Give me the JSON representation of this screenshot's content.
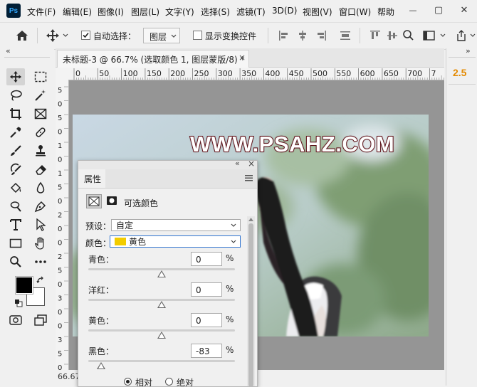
{
  "app": {
    "logo": "Ps"
  },
  "menubar": {
    "items": [
      "文件(F)",
      "编辑(E)",
      "图像(I)",
      "图层(L)",
      "文字(Y)",
      "选择(S)",
      "滤镜(T)",
      "3D(D)",
      "视图(V)",
      "窗口(W)",
      "帮助"
    ]
  },
  "window": {
    "minimize": "—",
    "restore": "▢",
    "close": "✕"
  },
  "options": {
    "auto_select_label": "自动选择：",
    "auto_select_checked": true,
    "target_value": "图层",
    "show_transform_label": "显示变换控件",
    "show_transform_checked": false
  },
  "document": {
    "tab_title": "未标题-3 @ 66.7% (选取颜色 1, 图层蒙版/8) *",
    "tab_close": "×",
    "ruler_h": [
      "0",
      "50",
      "100",
      "150",
      "200",
      "250",
      "300",
      "350",
      "400",
      "450",
      "500",
      "550",
      "600",
      "650",
      "700",
      "7"
    ],
    "ruler_v": [
      "5",
      "0",
      "5",
      "0",
      "1",
      "0",
      "1",
      "5",
      "0",
      "2",
      "0",
      "0",
      "2",
      "5",
      "0",
      "3",
      "0",
      "0",
      "3",
      "5",
      "0"
    ],
    "watermark": "WWW.PSAHZ.COM",
    "zoom": "66.67"
  },
  "right_panel": {
    "value": "2.5",
    "collapse": "»"
  },
  "toolbox": {
    "collapse": "«"
  },
  "properties": {
    "tab_label": "属性",
    "collapse": "«",
    "close": "×",
    "adjustment_name": "可选颜色",
    "preset_label": "预设：",
    "preset_value": "自定",
    "colors_label": "颜色：",
    "colors_value": "黄色",
    "colors_swatch": "#f2cc00",
    "sliders": [
      {
        "label": "青色：",
        "value": "0",
        "unit": "%",
        "fraction": 0.5
      },
      {
        "label": "洋红：",
        "value": "0",
        "unit": "%",
        "fraction": 0.5
      },
      {
        "label": "黄色：",
        "value": "0",
        "unit": "%",
        "fraction": 0.5
      },
      {
        "label": "黑色：",
        "value": "-83",
        "unit": "%",
        "fraction": 0.085
      }
    ],
    "method_relative": "相对",
    "method_absolute": "绝对",
    "method_selected": "相对"
  },
  "colors": {
    "foreground": "#000000",
    "background": "#ffffff",
    "accent": "#e48a00"
  }
}
